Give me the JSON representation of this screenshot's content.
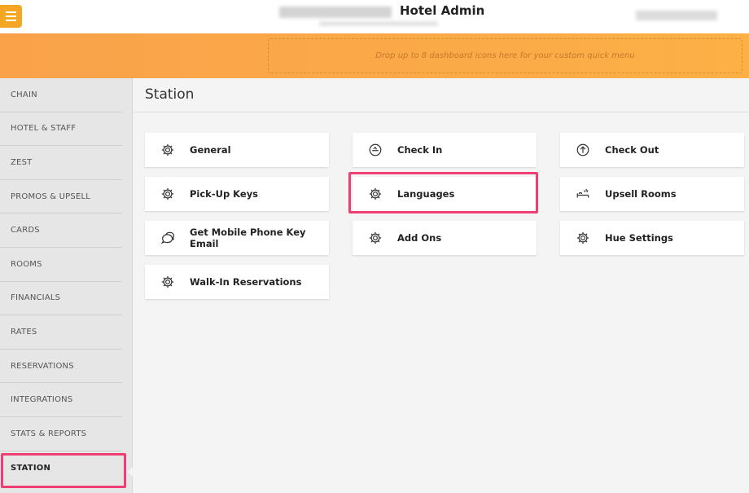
{
  "header": {
    "title": "Hotel Admin",
    "menu_icon": "hamburger-icon"
  },
  "quick_menu": {
    "drop_hint": "Drop up to 8 dashboard icons here for your custom quick menu"
  },
  "sidebar": {
    "items": [
      {
        "label": "CHAIN"
      },
      {
        "label": "HOTEL & STAFF"
      },
      {
        "label": "ZEST"
      },
      {
        "label": "PROMOS & UPSELL"
      },
      {
        "label": "CARDS"
      },
      {
        "label": "ROOMS"
      },
      {
        "label": "FINANCIALS"
      },
      {
        "label": "RATES"
      },
      {
        "label": "RESERVATIONS"
      },
      {
        "label": "INTEGRATIONS"
      },
      {
        "label": "STATS & REPORTS"
      },
      {
        "label": "STATION",
        "active": true
      }
    ]
  },
  "main": {
    "title": "Station",
    "cards": [
      {
        "label": "General",
        "icon": "gear-icon"
      },
      {
        "label": "Check In",
        "icon": "check-in-icon"
      },
      {
        "label": "Check Out",
        "icon": "check-out-icon"
      },
      {
        "label": "Pick-Up Keys",
        "icon": "gear-icon"
      },
      {
        "label": "Languages",
        "icon": "gear-icon",
        "highlighted": true
      },
      {
        "label": "Upsell Rooms",
        "icon": "upsell-bed-icon"
      },
      {
        "label": "Get Mobile Phone Key Email",
        "icon": "chat-bubbles-icon"
      },
      {
        "label": "Add Ons",
        "icon": "gear-icon"
      },
      {
        "label": "Hue Settings",
        "icon": "gear-icon"
      },
      {
        "label": "Walk-In Reservations",
        "icon": "gear-icon"
      }
    ]
  },
  "colors": {
    "accent_orange": "#f9a24a",
    "highlight_pink": "#ee3f74",
    "menu_button": "#f5a623"
  }
}
